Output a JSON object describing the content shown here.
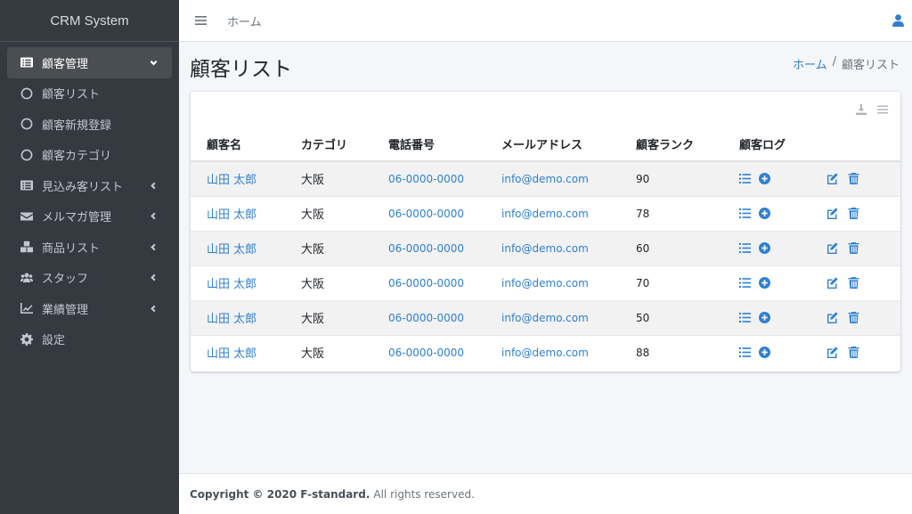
{
  "brand": "CRM System",
  "sidebar": {
    "items": [
      {
        "label": "顧客管理",
        "icon": "list-alt-icon",
        "active": true,
        "chevron": "down"
      },
      {
        "label": "顧客リスト",
        "icon": "circle-icon",
        "sub": true
      },
      {
        "label": "顧客新規登録",
        "icon": "circle-icon",
        "sub": true
      },
      {
        "label": "顧客カテゴリ",
        "icon": "circle-icon",
        "sub": true
      },
      {
        "label": "見込み客リスト",
        "icon": "list-alt-icon",
        "chevron": "left"
      },
      {
        "label": "メルマガ管理",
        "icon": "envelope-icon",
        "chevron": "left"
      },
      {
        "label": "商品リスト",
        "icon": "boxes-icon",
        "chevron": "left"
      },
      {
        "label": "スタッフ",
        "icon": "users-icon",
        "chevron": "left"
      },
      {
        "label": "業績管理",
        "icon": "chart-line-icon",
        "chevron": "left"
      },
      {
        "label": "設定",
        "icon": "gear-icon"
      }
    ]
  },
  "topbar": {
    "home": "ホーム"
  },
  "header": {
    "title": "顧客リスト",
    "breadcrumb": {
      "home": "ホーム",
      "sep": "/",
      "current": "顧客リスト"
    }
  },
  "table": {
    "columns": [
      "顧客名",
      "カテゴリ",
      "電話番号",
      "メールアドレス",
      "顧客ランク",
      "顧客ログ",
      ""
    ],
    "rows": [
      {
        "name": "山田 太郎",
        "category": "大阪",
        "phone": "06-0000-0000",
        "email": "info@demo.com",
        "rank": "90"
      },
      {
        "name": "山田 太郎",
        "category": "大阪",
        "phone": "06-0000-0000",
        "email": "info@demo.com",
        "rank": "78"
      },
      {
        "name": "山田 太郎",
        "category": "大阪",
        "phone": "06-0000-0000",
        "email": "info@demo.com",
        "rank": "60"
      },
      {
        "name": "山田 太郎",
        "category": "大阪",
        "phone": "06-0000-0000",
        "email": "info@demo.com",
        "rank": "70"
      },
      {
        "name": "山田 太郎",
        "category": "大阪",
        "phone": "06-0000-0000",
        "email": "info@demo.com",
        "rank": "50"
      },
      {
        "name": "山田 太郎",
        "category": "大阪",
        "phone": "06-0000-0000",
        "email": "info@demo.com",
        "rank": "88"
      }
    ]
  },
  "footer": {
    "copyright": "Copyright © 2020 F-standard.",
    "rights": "All rights reserved."
  },
  "colors": {
    "sidebar_bg": "#343a40",
    "accent": "#2f80d1",
    "active_item": "#494e53"
  }
}
